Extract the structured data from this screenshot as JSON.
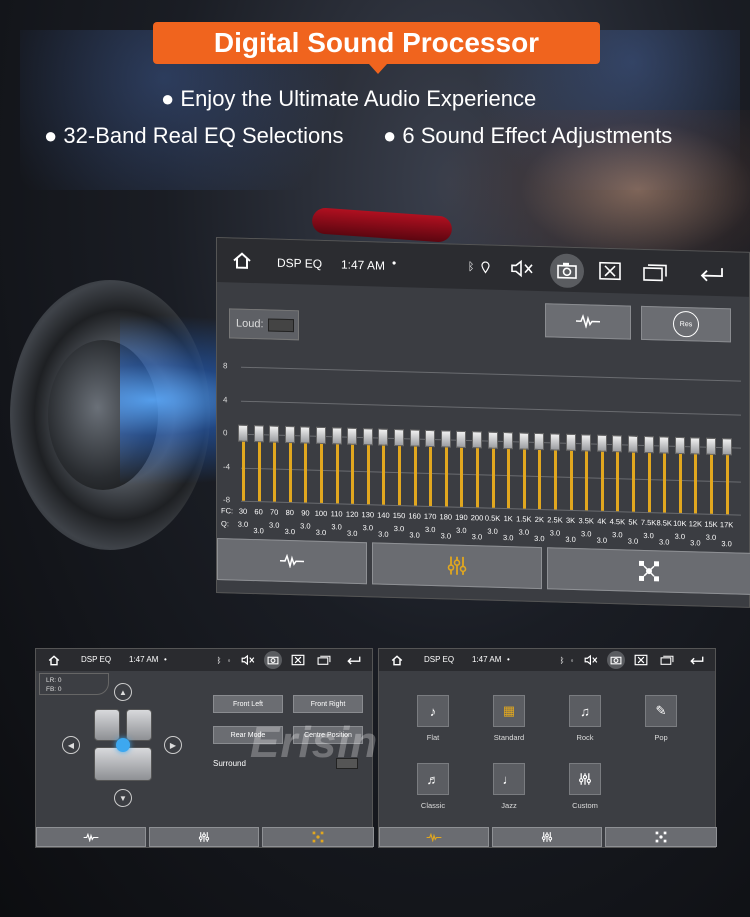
{
  "banner": {
    "title": "Digital Sound Processor",
    "bullet1": "● Enjoy the Ultimate Audio Experience",
    "bullet2": "● 32-Band Real EQ Selections",
    "bullet3": "● 6 Sound Effect Adjustments"
  },
  "main_screen": {
    "title": "DSP EQ",
    "time": "1:47 AM",
    "dot": "•",
    "loud_label": "Loud:",
    "reset_label": "Res",
    "y_ticks": [
      "8",
      "4",
      "0",
      "-4",
      "-8"
    ],
    "fc_label": "FC:",
    "q_label": "Q:",
    "bands": [
      "30",
      "60",
      "70",
      "80",
      "90",
      "100",
      "110",
      "120",
      "130",
      "140",
      "150",
      "160",
      "170",
      "180",
      "190",
      "200",
      "0.5K",
      "1K",
      "1.5K",
      "2K",
      "2.5K",
      "3K",
      "3.5K",
      "4K",
      "4.5K",
      "5K",
      "7.5K",
      "8.5K",
      "10K",
      "12K",
      "15K",
      "17K"
    ],
    "q_values": [
      "3.0",
      "3.0",
      "3.0",
      "3.0",
      "3.0",
      "3.0",
      "3.0",
      "3.0",
      "3.0",
      "3.0",
      "3.0",
      "3.0",
      "3.0",
      "3.0",
      "3.0",
      "3.0",
      "3.0",
      "3.0",
      "3.0",
      "3.0",
      "3.0",
      "3.0",
      "3.0",
      "3.0",
      "3.0",
      "3.0",
      "3.0",
      "3.0",
      "3.0",
      "3.0",
      "3.0",
      "3.0"
    ],
    "gains": [
      0,
      0,
      0,
      0,
      0,
      0,
      0,
      0,
      0,
      0,
      0,
      0,
      0,
      0,
      0,
      0,
      0,
      0,
      0,
      0,
      0,
      0,
      0,
      0,
      0,
      0,
      0,
      0,
      0,
      0,
      0,
      0
    ]
  },
  "left_screen": {
    "title": "DSP EQ",
    "time": "1:47 AM",
    "dot": "•",
    "lr": "LR: 0",
    "fb": "FB: 0",
    "front_left": "Front Left",
    "front_right": "Front Right",
    "rear_mode": "Rear Mode",
    "centre_position": "Centre Position",
    "surround": "Surround"
  },
  "right_screen": {
    "title": "DSP EQ",
    "time": "1:47 AM",
    "dot": "•",
    "effects": [
      "Flat",
      "Standard",
      "Rock",
      "Pop",
      "Classic",
      "Jazz",
      "Custom"
    ]
  },
  "watermark": "Erisin",
  "colors": {
    "accent": "#f0641e",
    "eq_bar": "#e1a71f",
    "active_tab": "#e1a71f"
  }
}
